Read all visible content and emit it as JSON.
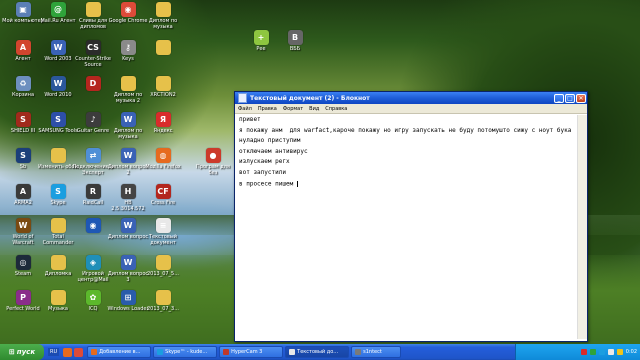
{
  "desktop_icons": [
    {
      "label": "Мой компьютер",
      "icon": "computer-icon",
      "color": "#5b7fb5",
      "glyph": "▣"
    },
    {
      "label": "Mail.Ru Агент",
      "icon": "mail-agent-icon",
      "color": "#2fa33a",
      "glyph": "@"
    },
    {
      "label": "Сливы для дипломов",
      "icon": "folder-icon",
      "color": "#e6c14a",
      "glyph": ""
    },
    {
      "label": "Google Chrome",
      "icon": "chrome-icon",
      "color": "#dd4b39",
      "glyph": "◉"
    },
    {
      "label": "Диплом по музыка",
      "icon": "folder-icon",
      "color": "#e6c14a",
      "glyph": ""
    },
    {
      "label": "Агент",
      "icon": "agent-icon",
      "color": "#d2452e",
      "glyph": "A"
    },
    {
      "label": "Word 2003",
      "icon": "word-icon",
      "color": "#3a62b5",
      "glyph": "W"
    },
    {
      "label": "Counter-Strike Source",
      "icon": "counter-strike-icon",
      "color": "#2b2b2b",
      "glyph": "CS"
    },
    {
      "label": "Keys",
      "icon": "keys-icon",
      "color": "#8a8a8a",
      "glyph": "⚷"
    },
    {
      "label": "",
      "icon": "folder-icon",
      "color": "#e6c14a",
      "glyph": ""
    },
    {
      "label": "Корзина",
      "icon": "recycle-bin-icon",
      "color": "#6d8fbf",
      "glyph": "♻"
    },
    {
      "label": "Word 2010",
      "icon": "word-icon",
      "color": "#2b579a",
      "glyph": "W"
    },
    {
      "label": "",
      "icon": "dota-icon",
      "color": "#b5261e",
      "glyph": "D"
    },
    {
      "label": "Диплом по музыка 2",
      "icon": "folder-icon",
      "color": "#e6c14a",
      "glyph": ""
    },
    {
      "label": "XRCTION2",
      "icon": "folder-icon",
      "color": "#e6c14a",
      "glyph": ""
    },
    {
      "label": "SHIELD III",
      "icon": "game-icon",
      "color": "#a12a1c",
      "glyph": "S"
    },
    {
      "label": "SAMSUNG Tools",
      "icon": "samsung-icon",
      "color": "#2d4fa8",
      "glyph": "S"
    },
    {
      "label": "Guitar Genre",
      "icon": "guitar-icon",
      "color": "#3c3c3c",
      "glyph": "♪"
    },
    {
      "label": "Диплом по музыка",
      "icon": "word-doc-icon",
      "color": "#3a62b5",
      "glyph": "W"
    },
    {
      "label": "Яндекс",
      "icon": "yandex-icon",
      "color": "#d92b2b",
      "glyph": "Я"
    },
    {
      "label": "Sb",
      "icon": "game-icon",
      "color": "#1b3f7a",
      "glyph": "S"
    },
    {
      "label": "Изменить обои",
      "icon": "folder-icon",
      "color": "#e6c14a",
      "glyph": ""
    },
    {
      "label": "Подключение к Эксперт",
      "icon": "network-icon",
      "color": "#4f8fd6",
      "glyph": "⇄"
    },
    {
      "label": "Диплом вопрос 2",
      "icon": "word-doc-icon",
      "color": "#3a62b5",
      "glyph": "W"
    },
    {
      "label": "Mozilla Firefox",
      "icon": "firefox-icon",
      "color": "#e66a1f",
      "glyph": "◍"
    },
    {
      "label": "Програм для без",
      "icon": "program-icon",
      "color": "#cc3a2a",
      "glyph": "●"
    },
    {
      "label": "ARMA2",
      "icon": "arma-icon",
      "color": "#3a3a3a",
      "glyph": "A"
    },
    {
      "label": "Skype",
      "icon": "skype-icon",
      "color": "#1b9ee0",
      "glyph": "S"
    },
    {
      "label": "RaidCall",
      "icon": "raidcall-icon",
      "color": "#3a3a3a",
      "glyph": "R"
    },
    {
      "label": "HB 2.5.3014.572",
      "icon": "app-icon",
      "color": "#444444",
      "glyph": "H"
    },
    {
      "label": "Cross Fire",
      "icon": "crossfire-icon",
      "color": "#b3261e",
      "glyph": "CF"
    },
    {
      "label": "World of Warcraft",
      "icon": "wow-icon",
      "color": "#7a4a12",
      "glyph": "W"
    },
    {
      "label": "Total Commander",
      "icon": "folder-icon",
      "color": "#e6c14a",
      "glyph": ""
    },
    {
      "label": "",
      "icon": "app-icon",
      "color": "#1e57b5",
      "glyph": "◉"
    },
    {
      "label": "Диплом вопрос",
      "icon": "word-doc-icon",
      "color": "#3a62b5",
      "glyph": "W"
    },
    {
      "label": "Текстовый документ",
      "icon": "text-doc-icon",
      "color": "#e8e8e8",
      "glyph": "≡"
    },
    {
      "label": "Steam",
      "icon": "steam-icon",
      "color": "#1d2a3a",
      "glyph": "◎"
    },
    {
      "label": "Дипломка",
      "icon": "folder-icon",
      "color": "#e6c14a",
      "glyph": ""
    },
    {
      "label": "Игровой центр@Mail",
      "icon": "game-center-icon",
      "color": "#1f8fb8",
      "glyph": "◈"
    },
    {
      "label": "Диплом вопрос 3",
      "icon": "word-doc-icon",
      "color": "#3a62b5",
      "glyph": "W"
    },
    {
      "label": "2013_07_5...",
      "icon": "folder-icon",
      "color": "#e6c14a",
      "glyph": ""
    },
    {
      "label": "Perfect World",
      "icon": "perfect-world-icon",
      "color": "#8a2d8a",
      "glyph": "P"
    },
    {
      "label": "Музыка",
      "icon": "folder-icon",
      "color": "#e6c14a",
      "glyph": ""
    },
    {
      "label": "ICQ",
      "icon": "icq-icon",
      "color": "#5cb82c",
      "glyph": "✿"
    },
    {
      "label": "Windows Loader",
      "icon": "windows-loader-icon",
      "color": "#2a5caa",
      "glyph": "⊞"
    },
    {
      "label": "2013_07_3...",
      "icon": "folder-icon",
      "color": "#e6c14a",
      "glyph": ""
    },
    {
      "label": "Рее",
      "icon": "add-icon",
      "color": "#8ec640",
      "glyph": "+"
    },
    {
      "label": "ВББ",
      "icon": "app-icon",
      "color": "#666666",
      "glyph": "B"
    }
  ],
  "notepad": {
    "title": "Текстовый документ (2) - Блокнот",
    "menu": [
      "Файл",
      "Правка",
      "Формат",
      "Вид",
      "Справка"
    ],
    "lines": [
      "привет",
      "я покажу анм  для warfact,кароче покажу но игру запускать не буду потомушто сижу с ноут бука",
      "нуладно приступим",
      "отключаем антивирус",
      "излускаем регх",
      "вот запустили",
      "в просесе пишем"
    ]
  },
  "taskbar": {
    "start_label": "пуск",
    "language": "RU",
    "tasks": [
      {
        "label": "Добавление в...",
        "color": "#e66a1f",
        "active": false
      },
      {
        "label": "Skype™ - kude...",
        "color": "#1b9ee0",
        "active": false
      },
      {
        "label": "HyperCam 3",
        "color": "#c0392b",
        "active": false
      },
      {
        "label": "Текстовый до...",
        "color": "#e8e8e8",
        "active": true
      },
      {
        "label": "s1ntect",
        "color": "#7a7a7a",
        "active": false
      }
    ],
    "clock": "0:02"
  }
}
